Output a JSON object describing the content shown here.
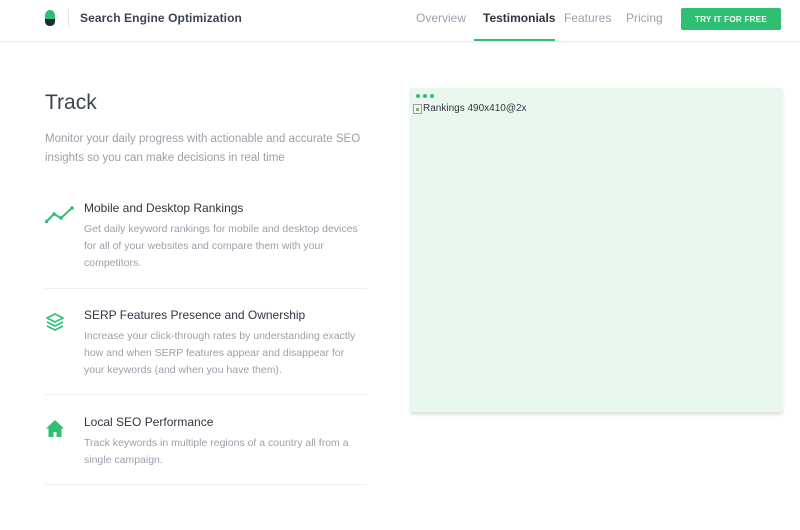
{
  "header": {
    "product_name": "Search Engine Optimization",
    "nav": [
      {
        "label": "Overview",
        "active": false
      },
      {
        "label": "Testimonials",
        "active": true
      },
      {
        "label": "Features",
        "active": false
      },
      {
        "label": "Pricing",
        "active": false
      }
    ],
    "cta_label": "TRY IT FOR FREE"
  },
  "section": {
    "title": "Track",
    "lead": "Monitor your daily progress with actionable and accurate SEO insights so you can make decisions in real time",
    "features": [
      {
        "icon": "trend-line-icon",
        "title": "Mobile and Desktop Rankings",
        "text": "Get daily keyword rankings for mobile and desktop devices for all of your websites and compare them with your competitors."
      },
      {
        "icon": "layers-icon",
        "title": "SERP Features Presence and Ownership",
        "text": "Increase your click-through rates by understanding exactly how and when SERP features appear and disappear for your keywords (and when you have them)."
      },
      {
        "icon": "home-icon",
        "title": "Local SEO Performance",
        "text": "Track keywords in multiple regions of a country all from a single campaign."
      }
    ]
  },
  "preview": {
    "image_alt": "Rankings 490x410@2x"
  },
  "colors": {
    "accent": "#2fbf71",
    "preview_bg": "#eaf7ee",
    "text_dark": "#3d4450",
    "text_muted": "#9aa1ab"
  }
}
